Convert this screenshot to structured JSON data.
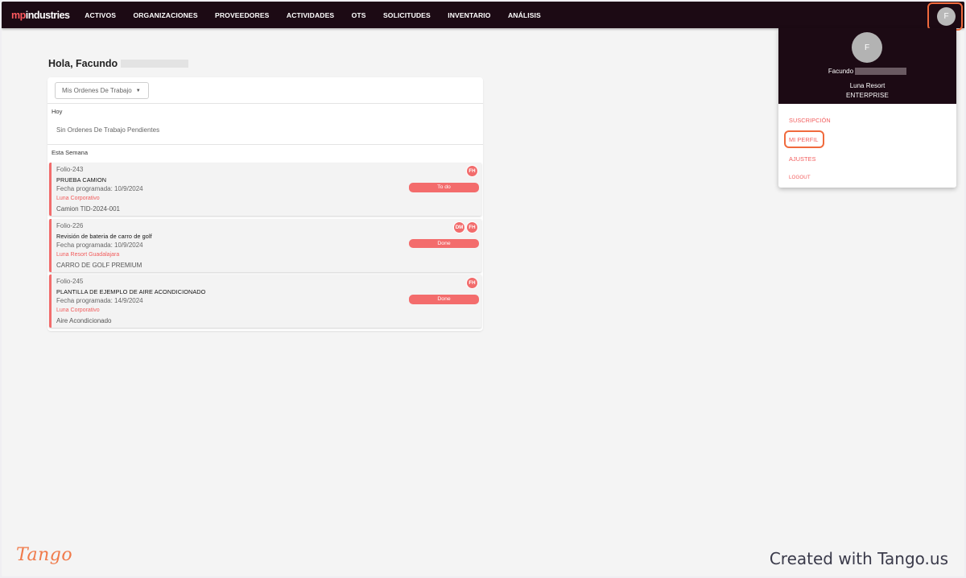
{
  "app": {
    "logo_prefix": "mp",
    "logo_rest": "industries"
  },
  "nav": {
    "items": [
      "ACTIVOS",
      "ORGANIZACIONES",
      "PROVEEDORES",
      "ACTIVIDADES",
      "OTS",
      "SOLICITUDES",
      "INVENTARIO",
      "ANÁLISIS"
    ],
    "avatar_initial": "F"
  },
  "main": {
    "greeting": "Hola, Facundo",
    "filter_label": "Mis Ordenes De Trabajo",
    "today_label": "Hoy",
    "empty_today": "Sin Ordenes De Trabajo Pendientes",
    "week_label": "Esta Semana",
    "work_orders": [
      {
        "folio": "Folio-243",
        "title": "PRUEBA CAMION",
        "date": "Fecha programada: 10/9/2024",
        "location": "Luna Corporativo",
        "asset": "Camion TID-2024-001",
        "status": "To do",
        "assignees": [
          "FH"
        ]
      },
      {
        "folio": "Folio-226",
        "title": "Revisión de bateria de carro de golf",
        "date": "Fecha programada: 10/9/2024",
        "location": "Luna Resort Guadalajara",
        "asset": "CARRO DE GOLF PREMIUM",
        "status": "Done",
        "assignees": [
          "DM",
          "FH"
        ]
      },
      {
        "folio": "Folio-245",
        "title": "PLANTILLA DE EJEMPLO DE AIRE ACONDICIONADO",
        "date": "Fecha programada: 14/9/2024",
        "location": "Luna Corporativo",
        "asset": "Aire Acondicionado",
        "status": "Done",
        "assignees": [
          "FH"
        ]
      }
    ]
  },
  "profile_menu": {
    "initial": "F",
    "name": "Facundo",
    "org": "Luna Resort",
    "plan": "ENTERPRISE",
    "items": {
      "subscription": "SUSCRIPCIÓN",
      "profile": "MI PERFIL",
      "settings": "AJUSTES",
      "logout": "LOGOUT"
    }
  },
  "footer": {
    "tango_logo": "Tango",
    "created_with": "Created with Tango.us"
  },
  "colors": {
    "nav_bg": "#1c0a14",
    "accent": "#f26c6c",
    "highlight": "#f06a3d"
  }
}
